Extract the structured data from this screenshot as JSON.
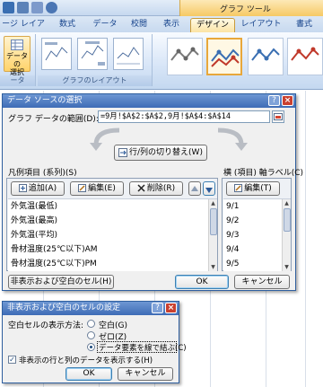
{
  "ribbon": {
    "title_context": "グラフ ツール",
    "tabs": [
      "ージ レイアウト",
      "数式",
      "データ",
      "校閲",
      "表示",
      "デザイン",
      "レイアウト",
      "書式"
    ],
    "active_tab": "デザイン",
    "data_button_label_1": "データの",
    "data_button_label_2": "選択",
    "group_data": "ータ",
    "group_chart_layouts": "グラフのレイアウト"
  },
  "source_dialog": {
    "title": "データ ソースの選択",
    "range_label": "グラフ データの範囲(D):",
    "range_value": "=9月!$A$2:$A$2,9月!$A$4:$A$14",
    "switch_button": "行/列の切り替え(W)",
    "series_header": "凡例項目 (系列)(S)",
    "add_button": "追加(A)",
    "edit_button": "編集(E)",
    "delete_button": "削除(R)",
    "series": [
      "外気温(最低)",
      "外気温(最高)",
      "外気温(平均)",
      "骨材温度(25℃以下)AM",
      "骨材温度(25℃以下)PM"
    ],
    "axis_header": "横 (項目) 軸ラベル(C)",
    "axis_edit_button": "編集(T)",
    "axis_labels": [
      "9/1",
      "9/2",
      "9/3",
      "9/4",
      "9/5"
    ],
    "hidden_cells_button": "非表示および空白のセル(H)",
    "ok": "OK",
    "cancel": "キャンセル"
  },
  "hidden_dialog": {
    "title": "非表示および空白のセルの設定",
    "empty_label": "空白セルの表示方法:",
    "option_gap": "空白(G)",
    "option_zero": "ゼロ(Z)",
    "option_connect": "データ要素を線で結ぶ(C)",
    "selected_option": "データ要素を線で結ぶ(C)",
    "show_hidden": "非表示の行と列のデータを表示する(H)",
    "show_hidden_checked": true,
    "ok": "OK",
    "cancel": "キャンセル"
  },
  "icons": [
    "save-icon",
    "undo-icon",
    "help-icon",
    "close-icon",
    "range-picker-icon",
    "switch-icon",
    "add-icon",
    "edit-icon",
    "delete-icon",
    "up-arrow-icon",
    "down-arrow-icon"
  ],
  "colors": {
    "title_bar": "#3e6cb6",
    "active_tab": "#fbe3a4",
    "close_button": "#c9402f"
  }
}
